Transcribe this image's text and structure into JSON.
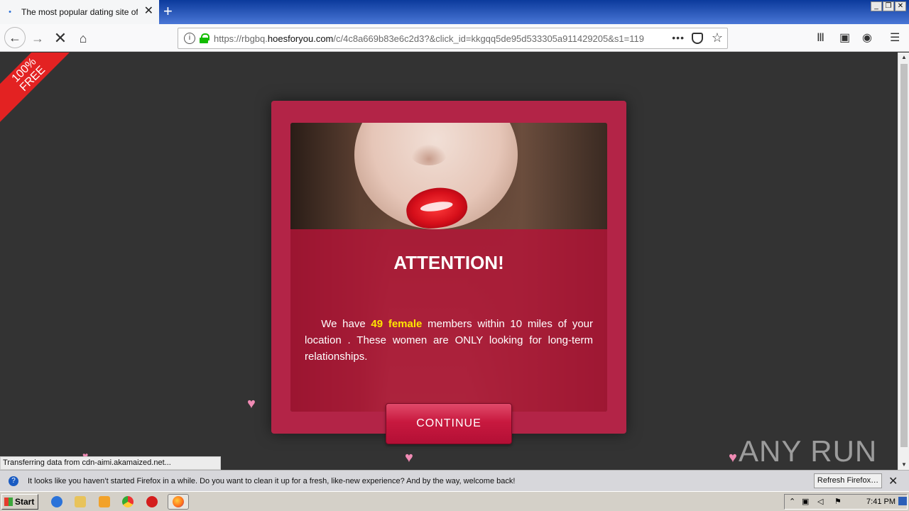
{
  "browser": {
    "tab_title": "The most popular dating site of the",
    "url_prefix": "https://rbgbq.",
    "url_domain": "hoesforyou.com",
    "url_path": "/c/4c8a669b83e6c2d3?&click_id=kkgqq5de95d533305a911429205&s1=119"
  },
  "page": {
    "ribbon_text_1": "100%",
    "ribbon_text_2": "FREE",
    "modal": {
      "heading": "ATTENTION!",
      "msg_pre": "We have ",
      "msg_highlight": "49 female",
      "msg_post": " members within 10 miles of your location . These women are ONLY looking for long-term relationships.",
      "continue_label": "CONTINUE"
    },
    "hearts": [
      "♥",
      "♥",
      "♥",
      "♥"
    ]
  },
  "status_text": "Transferring data from cdn-aimi.akamaized.net...",
  "watermark": "ANY RUN",
  "notification": {
    "text": "It looks like you haven’t started Firefox in a while. Do you want to clean it up for a fresh, like-new experience? And by the way, welcome back!",
    "button": "Refresh Firefox…"
  },
  "taskbar": {
    "start_label": "Start",
    "clock": "7:41 PM"
  },
  "colors": {
    "modal": "#b32447",
    "highlight": "#ffe600",
    "ribbon": "#e32222"
  }
}
